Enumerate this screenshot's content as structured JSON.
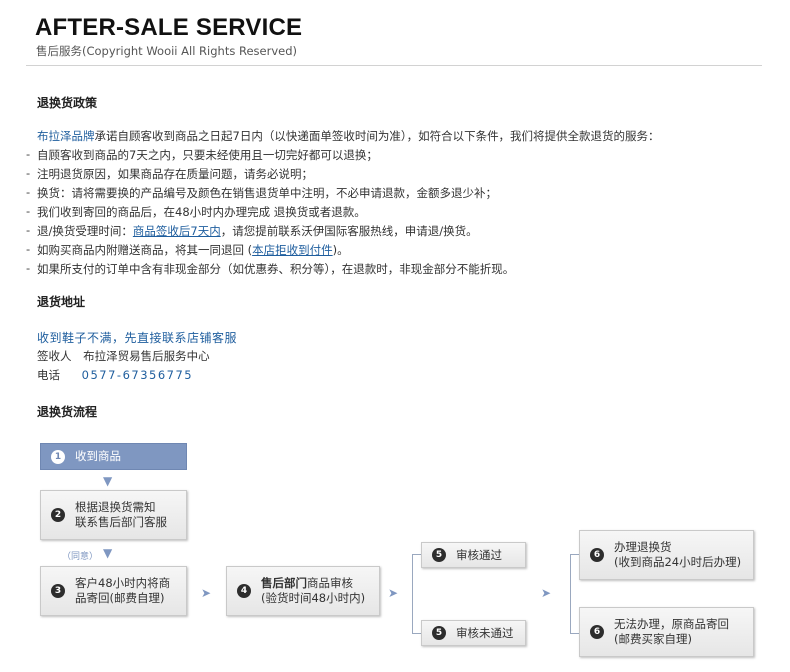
{
  "header": {
    "title": "AFTER-SALE SERVICE",
    "subtitle": "售后服务(Copyright Wooii All Rights Reserved)"
  },
  "policy": {
    "heading": "退换货政策",
    "intro_brand": "布拉泽品牌",
    "intro_rest": "承诺自顾客收到商品之日起7日内（以快递面单签收时间为准），如符合以下条件，我们将提供全款退货的服务：",
    "bullets": [
      "自顾客收到商品的7天之内，只要未经使用且一切完好都可以退换；",
      "注明退货原因，如果商品存在质量问题，请务必说明；",
      "换货：请将需要换的产品编号及颜色在销售退货单中注明，不必申请退款，金额多退少补；",
      "我们收到寄回的商品后，在48小时内办理完成 退换货或者退款。"
    ],
    "bullet5_pre": "退/换货受理时间：",
    "bullet5_link": "商品签收后7天内",
    "bullet5_post": "，请您提前联系沃伊国际客服热线，申请退/换货。",
    "bullet6_pre": "如购买商品内附赠送商品，将其一同退回 (",
    "bullet6_link": "本店拒收到付件",
    "bullet6_post": ")。",
    "bullet7": "如果所支付的订单中含有非现金部分（如优惠券、积分等），在退款时，非现金部分不能折现。"
  },
  "address": {
    "heading": "退货地址",
    "notice": "收到鞋子不满，先直接联系店铺客服",
    "receiver_label": "签收人",
    "receiver_value": "布拉泽贸易售后服务中心",
    "phone_label": "电话",
    "phone_value": "0577-67356775"
  },
  "flow": {
    "heading": "退换货流程",
    "agree_label": "（同意）",
    "steps": {
      "s1": {
        "num": "1",
        "label": "收到商品"
      },
      "s2": {
        "num": "2",
        "line1": "根据退换货需知",
        "line2": "联系售后部门客服"
      },
      "s3": {
        "num": "3",
        "line1": "客户48小时内将商",
        "line2": "品寄回(邮费自理)"
      },
      "s4": {
        "num": "4",
        "bold": "售后部门",
        "line1_rest": "商品审核",
        "line2": "(验货时间48小时内)"
      },
      "s5a": {
        "num": "5",
        "label": "审核通过"
      },
      "s5b": {
        "num": "5",
        "label": "审核未通过"
      },
      "s6a": {
        "num": "6",
        "line1": "办理退换货",
        "line2": "(收到商品24小时后办理)"
      },
      "s6b": {
        "num": "6",
        "line1": "无法办理，原商品寄回",
        "line2": "(邮费买家自理)"
      }
    }
  }
}
